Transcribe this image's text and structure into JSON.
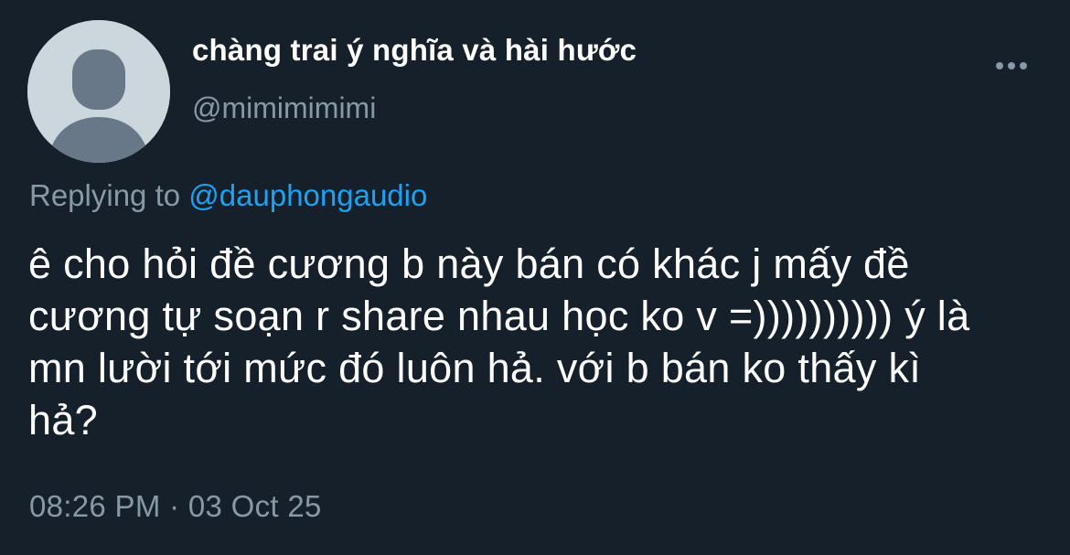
{
  "author": {
    "display_name": "chàng trai ý nghĩa và hài hước",
    "handle": "@mimimimimi",
    "avatar": "default-avatar-icon"
  },
  "menu": {
    "icon": "more-horizontal-icon"
  },
  "reply": {
    "prefix": "Replying to",
    "mention": "@dauphongaudio"
  },
  "body": {
    "lines": [
      "ê cho hỏi đề cương b này bán có khác j mấy đề",
      "cương tự soạn r share nhau học ko v =)))))))))) ý là",
      "mn lười tới mức đó luôn hả. với b bán ko thấy kì",
      "hả?"
    ]
  },
  "meta": {
    "timestamp": "08:26 PM · 03 Oct 25"
  },
  "colors": {
    "background": "#15202b",
    "primary_text": "#ffffff",
    "secondary_text": "#8899a6",
    "link": "#1da1f2",
    "avatar_bg": "#ccd6dd",
    "avatar_figure": "#687888"
  }
}
